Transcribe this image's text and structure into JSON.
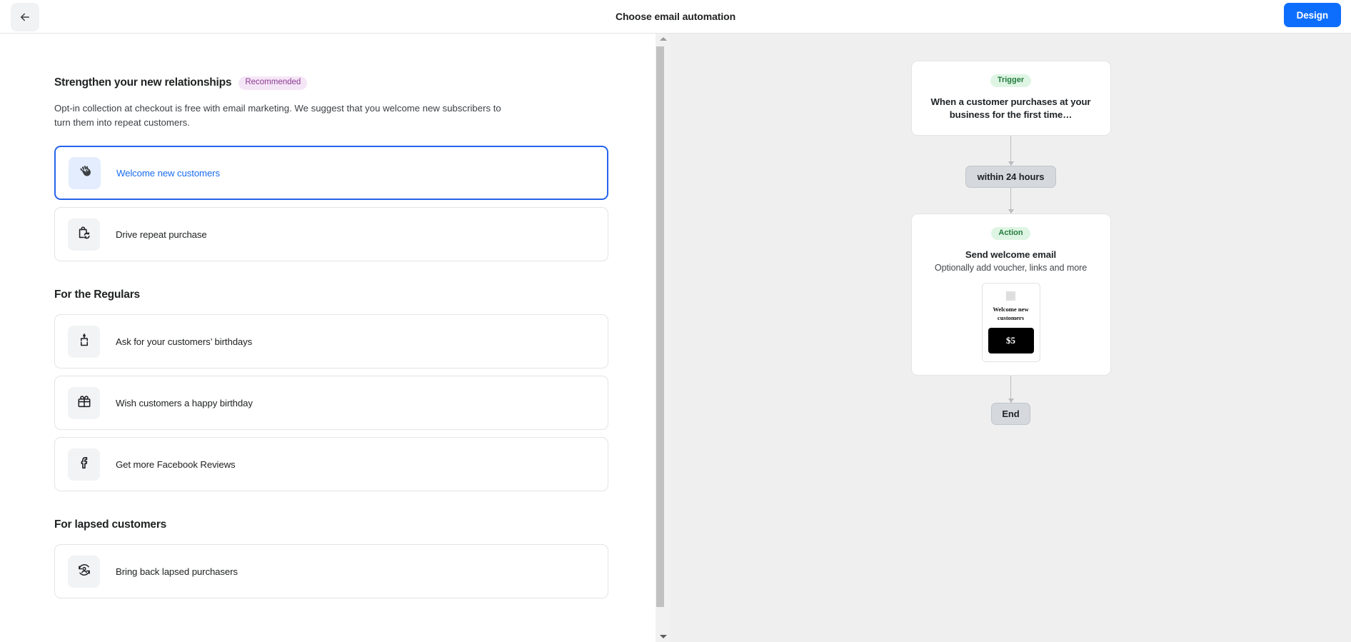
{
  "topbar": {
    "back_icon": "arrow-left-icon",
    "title": "Choose email automation",
    "design_label": "Design"
  },
  "left_panel": {
    "sections": [
      {
        "title": "Strengthen your new relationships",
        "badge": "Recommended",
        "description": "Opt-in collection at checkout is free with email marketing. We suggest that you welcome new subscribers to turn them into repeat customers.",
        "items": [
          {
            "label": "Welcome new customers",
            "icon": "waving-hand-icon",
            "selected": true
          },
          {
            "label": "Drive repeat purchase",
            "icon": "shopping-bag-refresh-icon",
            "selected": false
          }
        ]
      },
      {
        "title": "For the Regulars",
        "badge": "",
        "description": "",
        "items": [
          {
            "label": "Ask for your customers’ birthdays",
            "icon": "birthday-cake-icon",
            "selected": false
          },
          {
            "label": "Wish customers a happy birthday",
            "icon": "gift-icon",
            "selected": false
          },
          {
            "label": "Get more Facebook Reviews",
            "icon": "facebook-icon",
            "selected": false
          }
        ]
      },
      {
        "title": "For lapsed customers",
        "badge": "",
        "description": "",
        "items": [
          {
            "label": "Bring back lapsed purchasers",
            "icon": "person-refresh-icon",
            "selected": false
          }
        ]
      }
    ]
  },
  "flow": {
    "trigger": {
      "badge": "Trigger",
      "title": "When a customer purchases at your business for the first time…"
    },
    "delay": {
      "label": "within 24 hours"
    },
    "action": {
      "badge": "Action",
      "title": "Send welcome email",
      "subtitle": "Optionally add voucher, links and more",
      "preview": {
        "heading": "Welcome new customers",
        "button_label": "$5"
      }
    },
    "end": {
      "label": "End"
    }
  },
  "colors": {
    "accent_blue": "#0d6efd",
    "selected_border": "#2563eb",
    "badge_recommended_bg": "#f5e6f7",
    "badge_recommended_text": "#8a3a8f",
    "flow_badge_bg": "#dff5e4",
    "flow_badge_text": "#237c3d",
    "canvas_bg": "#efefef"
  }
}
